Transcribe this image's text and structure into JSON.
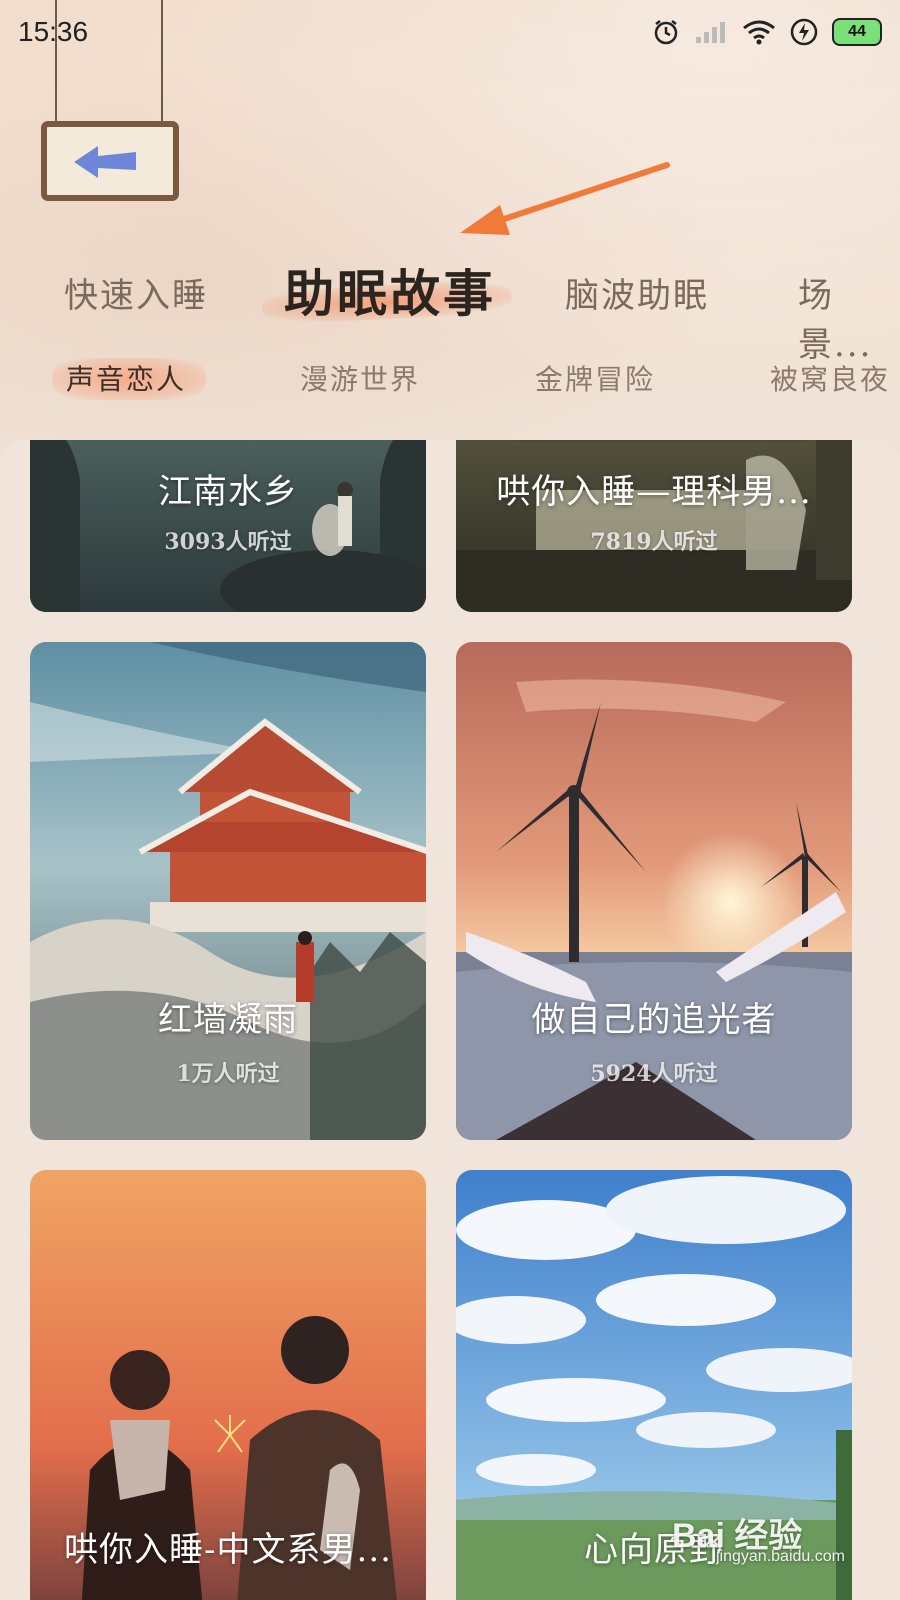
{
  "status": {
    "time": "15:36",
    "battery": "44"
  },
  "tabs": [
    {
      "label": "快速入睡"
    },
    {
      "label": "助眠故事"
    },
    {
      "label": "脑波助眠"
    },
    {
      "label": "场景..."
    }
  ],
  "subtabs": [
    {
      "label": "声音恋人"
    },
    {
      "label": "漫游世界"
    },
    {
      "label": "金牌冒险"
    },
    {
      "label": "被窝良夜"
    }
  ],
  "cards": [
    {
      "title": "江南水乡",
      "listens": "3093人听过"
    },
    {
      "title": "哄你入睡—理科男...",
      "listens": "7819人听过"
    },
    {
      "title": "红墙凝雨",
      "listens": "1万人听过"
    },
    {
      "title": "做自己的追光者",
      "listens": "5924人听过"
    },
    {
      "title": "哄你入睡-中文系男...",
      "listens": ""
    },
    {
      "title": "心向原野",
      "listens": ""
    }
  ],
  "watermark": {
    "logo": "Bai 经验",
    "url": "jingyan.baidu.com"
  },
  "colors": {
    "accent": "#f0966e",
    "arrow": "#f07a3a",
    "tab_active": "#2b241f"
  }
}
